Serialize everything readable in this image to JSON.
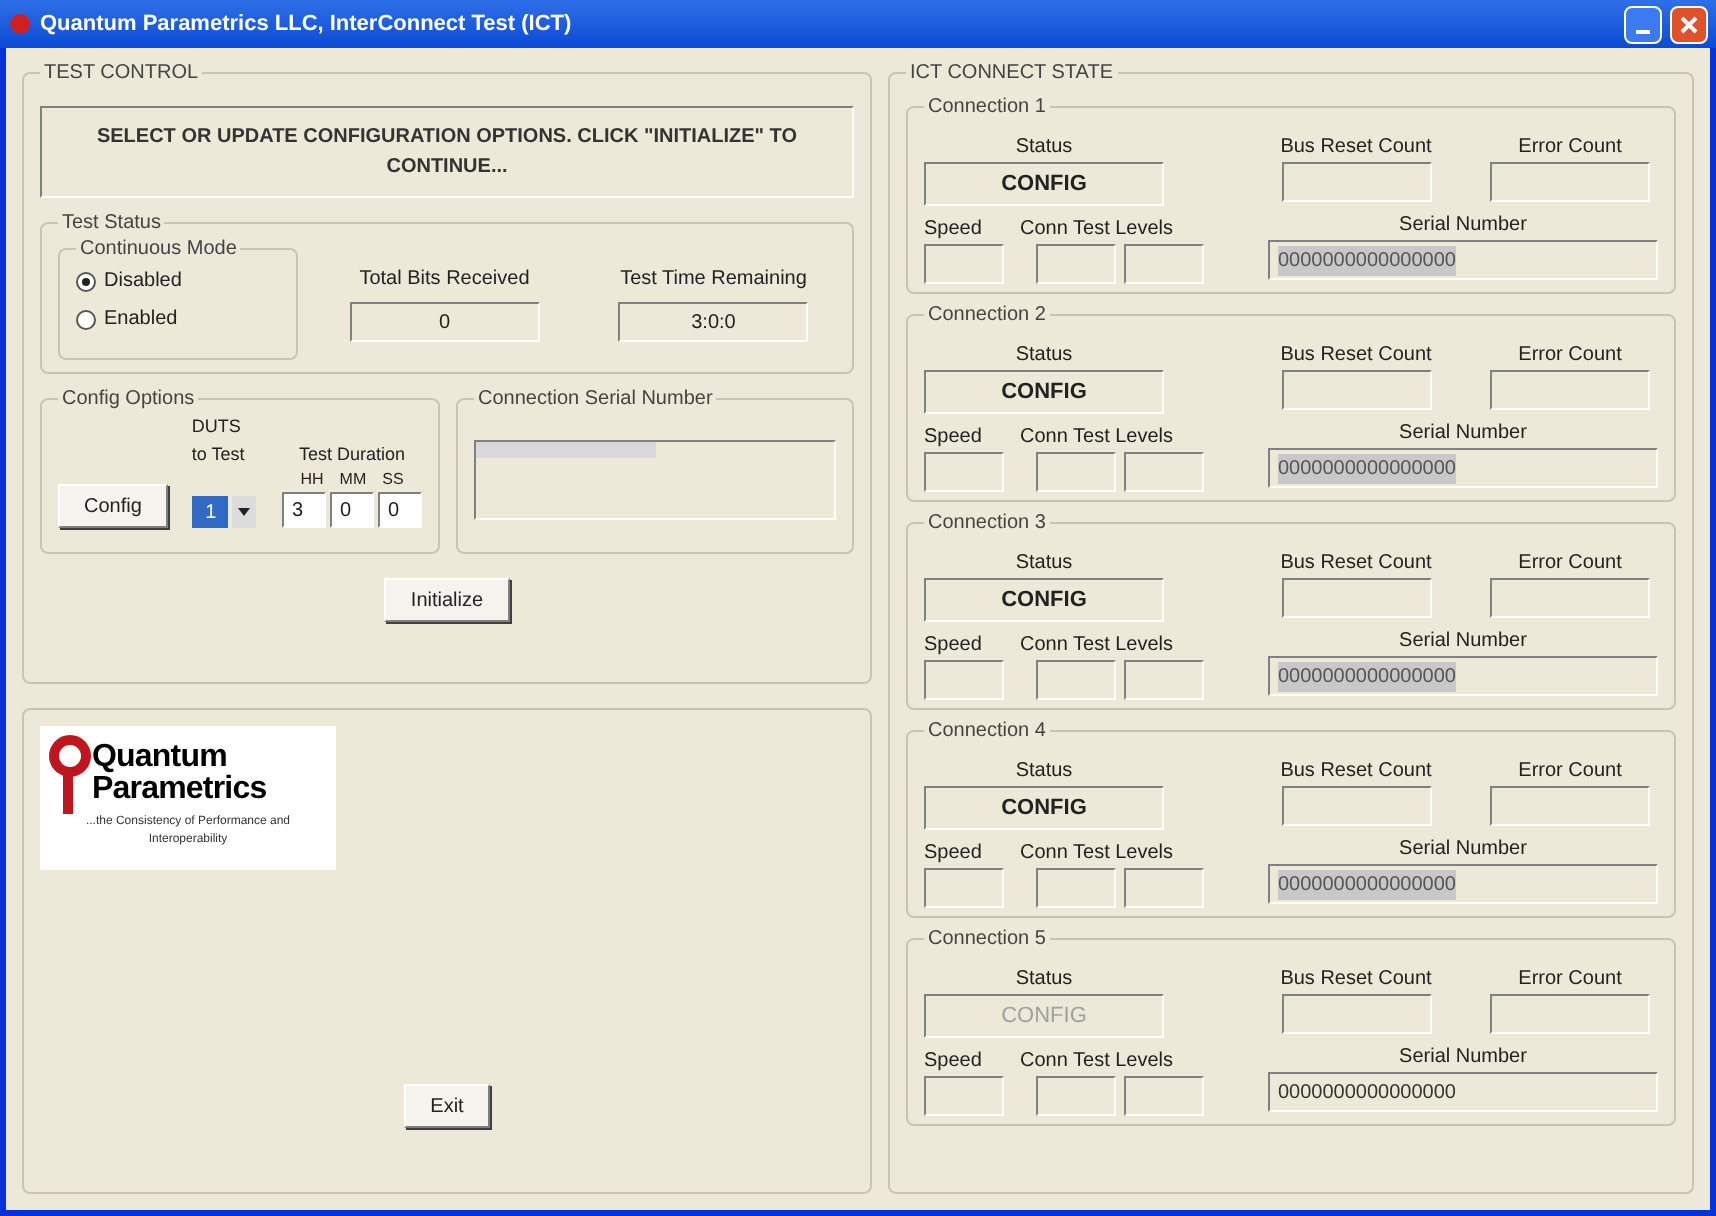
{
  "window": {
    "title": "Quantum Parametrics LLC, InterConnect Test (ICT)"
  },
  "test_control": {
    "title": "TEST CONTROL",
    "message": "SELECT OR UPDATE CONFIGURATION OPTIONS. CLICK \"INITIALIZE\" TO CONTINUE...",
    "test_status": {
      "title": "Test Status",
      "continuous_mode": {
        "title": "Continuous Mode",
        "options": [
          {
            "label": "Disabled",
            "selected": true
          },
          {
            "label": "Enabled",
            "selected": false
          }
        ]
      },
      "total_bits_received": {
        "label": "Total Bits Received",
        "value": "0"
      },
      "test_time_remaining": {
        "label": "Test Time Remaining",
        "value": "3:0:0"
      }
    },
    "config_options": {
      "title": "Config Options",
      "config_button": "Config",
      "duts_label": "DUTS to Test",
      "duts_value": "1",
      "duration_label": "Test Duration",
      "duration_units": [
        "HH",
        "MM",
        "SS"
      ],
      "duration_values": [
        "3",
        "0",
        "0"
      ]
    },
    "connection_serial": {
      "title": "Connection Serial Number"
    },
    "initialize_button": "Initialize"
  },
  "logo": {
    "name": "Quantum",
    "name_2": "Parametrics",
    "tagline": "...the Consistency of Performance and Interoperability"
  },
  "exit_button": "Exit",
  "ict_connect_state": {
    "title": "ICT CONNECT STATE",
    "connections": [
      {
        "title": "Connection 1",
        "labels": {
          "status": "Status",
          "bus_reset": "Bus Reset Count",
          "error": "Error Count",
          "speed": "Speed",
          "levels": "Conn Test Levels",
          "serial": "Serial Number"
        },
        "status": "CONFIG",
        "disabled": false,
        "serial": "0000000000000000",
        "serial_highlighted": true
      },
      {
        "title": "Connection 2",
        "labels": {
          "status": "Status",
          "bus_reset": "Bus Reset Count",
          "error": "Error Count",
          "speed": "Speed",
          "levels": "Conn Test Levels",
          "serial": "Serial Number"
        },
        "status": "CONFIG",
        "disabled": false,
        "serial": "0000000000000000",
        "serial_highlighted": true
      },
      {
        "title": "Connection 3",
        "labels": {
          "status": "Status",
          "bus_reset": "Bus Reset Count",
          "error": "Error Count",
          "speed": "Speed",
          "levels": "Conn Test Levels",
          "serial": "Serial Number"
        },
        "status": "CONFIG",
        "disabled": false,
        "serial": "0000000000000000",
        "serial_highlighted": true
      },
      {
        "title": "Connection 4",
        "labels": {
          "status": "Status",
          "bus_reset": "Bus Reset Count",
          "error": "Error Count",
          "speed": "Speed",
          "levels": "Conn Test Levels",
          "serial": "Serial Number"
        },
        "status": "CONFIG",
        "disabled": false,
        "serial": "0000000000000000",
        "serial_highlighted": true
      },
      {
        "title": "Connection 5",
        "labels": {
          "status": "Status",
          "bus_reset": "Bus Reset Count",
          "error": "Error Count",
          "speed": "Speed",
          "levels": "Conn Test Levels",
          "serial": "Serial Number"
        },
        "status": "CONFIG",
        "disabled": true,
        "serial": "0000000000000000",
        "serial_highlighted": false
      }
    ]
  }
}
